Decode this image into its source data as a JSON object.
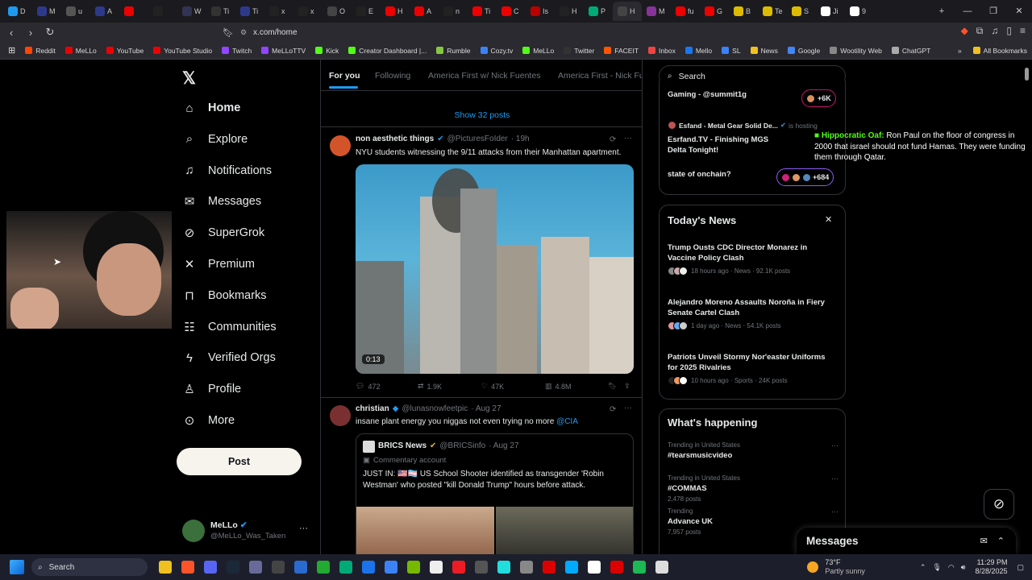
{
  "tabs": [
    {
      "label": "D",
      "color": "#1d9bf0"
    },
    {
      "label": "M",
      "color": "#2d3a8c"
    },
    {
      "label": "u",
      "color": "#555"
    },
    {
      "label": "A",
      "color": "#2d3a8c"
    },
    {
      "label": "",
      "color": "#e00"
    },
    {
      "label": "",
      "color": "#222"
    },
    {
      "label": "W",
      "color": "#335"
    },
    {
      "label": "Ti",
      "color": "#333"
    },
    {
      "label": "Ti",
      "color": "#2d3a8c"
    },
    {
      "label": "x",
      "color": "#222"
    },
    {
      "label": "x",
      "color": "#222"
    },
    {
      "label": "O",
      "color": "#444"
    },
    {
      "label": "E",
      "color": "#222"
    },
    {
      "label": "H",
      "color": "#e00"
    },
    {
      "label": "A",
      "color": "#e00"
    },
    {
      "label": "n",
      "color": "#222"
    },
    {
      "label": "Ti",
      "color": "#e00"
    },
    {
      "label": "C",
      "color": "#e00"
    },
    {
      "label": "Is",
      "color": "#b00"
    },
    {
      "label": "H",
      "color": "#222"
    },
    {
      "label": "P",
      "color": "#0a7"
    },
    {
      "label": "H",
      "color": "#444"
    },
    {
      "label": "M",
      "color": "#839"
    },
    {
      "label": "fu",
      "color": "#e00"
    },
    {
      "label": "G",
      "color": "#e00"
    },
    {
      "label": "B",
      "color": "#db0"
    },
    {
      "label": "Te",
      "color": "#db0"
    },
    {
      "label": "S",
      "color": "#db0"
    },
    {
      "label": "Ji",
      "color": "#fff"
    },
    {
      "label": "9",
      "color": "#fff"
    }
  ],
  "address": {
    "url": "x.com/home"
  },
  "bookmarks": [
    {
      "label": "Reddit",
      "color": "#ff4500"
    },
    {
      "label": "MeLLo",
      "color": "#e00"
    },
    {
      "label": "YouTube",
      "color": "#e00"
    },
    {
      "label": "YouTube Studio",
      "color": "#e00"
    },
    {
      "label": "Twitch",
      "color": "#9146ff"
    },
    {
      "label": "MeLLoTTV",
      "color": "#9146ff"
    },
    {
      "label": "Kick",
      "color": "#53fc18"
    },
    {
      "label": "Creator Dashboard |...",
      "color": "#53fc18"
    },
    {
      "label": "Rumble",
      "color": "#85c742"
    },
    {
      "label": "Cozy.tv",
      "color": "#3b82f6"
    },
    {
      "label": "MeLLo",
      "color": "#53fc18"
    },
    {
      "label": "Twitter",
      "color": "#333"
    },
    {
      "label": "FACEIT",
      "color": "#f50"
    },
    {
      "label": "Inbox",
      "color": "#e44"
    },
    {
      "label": "Mello",
      "color": "#1877f2"
    },
    {
      "label": "SL",
      "color": "#3b82f6"
    },
    {
      "label": "News",
      "color": "#f0c020"
    },
    {
      "label": "Google",
      "color": "#4285f4"
    },
    {
      "label": "Wootility Web",
      "color": "#888"
    },
    {
      "label": "ChatGPT",
      "color": "#aaa"
    }
  ],
  "all_bookmarks": "All Bookmarks",
  "nav": {
    "items": [
      {
        "label": "Home",
        "icon": "home-icon"
      },
      {
        "label": "Explore",
        "icon": "search-icon"
      },
      {
        "label": "Notifications",
        "icon": "bell-icon"
      },
      {
        "label": "Messages",
        "icon": "mail-icon"
      },
      {
        "label": "SuperGrok",
        "icon": "grok-icon"
      },
      {
        "label": "Premium",
        "icon": "x-icon"
      },
      {
        "label": "Bookmarks",
        "icon": "bookmark-icon"
      },
      {
        "label": "Communities",
        "icon": "people-icon"
      },
      {
        "label": "Verified Orgs",
        "icon": "bolt-icon"
      },
      {
        "label": "Profile",
        "icon": "person-icon"
      },
      {
        "label": "More",
        "icon": "more-icon"
      }
    ],
    "post": "Post",
    "profile_name": "MeLLo",
    "profile_handle": "@MeLLo_Was_Taken"
  },
  "feed": {
    "tabs": [
      "For you",
      "Following",
      "America First w/ Nick Fuentes",
      "America First - Nick Fu"
    ],
    "show_posts": "Show 32 posts",
    "post1": {
      "name": "non aesthetic things",
      "handle": "@PicturesFoIder",
      "time": "· 19h",
      "text": "NYU students witnessing the 9/11 attacks from their Manhattan apartment.",
      "duration": "0:13",
      "replies": "472",
      "reposts": "1.9K",
      "likes": "47K",
      "views": "4.8M"
    },
    "post2": {
      "name": "christian",
      "handle": "@lunasnowfeetpic",
      "time": "· Aug 27",
      "text": "insane plant energy you niggas not even trying no more",
      "mention": "@CIA",
      "quote_name": "BRICS News",
      "quote_handle": "@BRICSinfo",
      "quote_time": "· Aug 27",
      "quote_label": "Commentary account",
      "quote_text": "JUST IN: 🇺🇸🏳️‍⚧️ US School Shooter identified as transgender 'Robin Westman' who posted \"kill Donald Trump\" hours before attack."
    }
  },
  "search": {
    "placeholder": "Search"
  },
  "live": {
    "row1": "Gaming - @summit1g",
    "row1_count": "+6K",
    "row2_host": "Esfand - Metal Gear Solid De...",
    "row2_hosting": "is hosting",
    "row2_title": "Esrfand.TV - Finishing MGS Delta Tonight!",
    "row3": "state of onchain?",
    "row3_count": "+684"
  },
  "chat_overlay": {
    "user": "Hippocratic Oaf:",
    "text": "Ron Paul on the floor of congress in 2000 that israel should not fund Hamas. They were funding them through Qatar."
  },
  "news": {
    "heading": "Today's News",
    "items": [
      {
        "title": "Trump Ousts CDC Director Monarez in Vaccine Policy Clash",
        "meta": "18 hours ago · News · 92.1K posts"
      },
      {
        "title": "Alejandro Moreno Assaults Noroña in Fiery Senate Cartel Clash",
        "meta": "1 day ago · News · 54.1K posts"
      },
      {
        "title": "Patriots Unveil Stormy Nor'easter Uniforms for 2025 Rivalries",
        "meta": "10 hours ago · Sports · 24K posts"
      }
    ]
  },
  "happening": {
    "heading": "What's happening",
    "items": [
      {
        "context": "Trending in United States",
        "title": "#tearsmusicvideo",
        "count": ""
      },
      {
        "context": "Trending in United States",
        "title": "#COMMAS",
        "count": "2,478 posts"
      },
      {
        "context": "Trending",
        "title": "Advance UK",
        "count": "7,957 posts"
      }
    ]
  },
  "messages": {
    "label": "Messages"
  },
  "taskbar": {
    "search": "Search",
    "weather_temp": "73°F",
    "weather_desc": "Partly sunny",
    "time": "11:29 PM",
    "date": "8/28/2025"
  }
}
